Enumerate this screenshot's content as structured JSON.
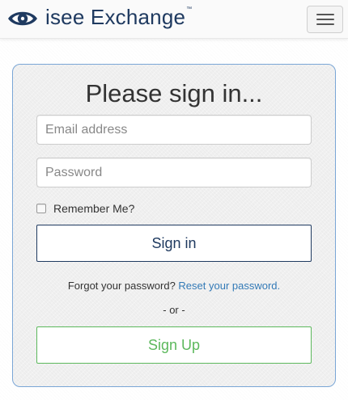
{
  "header": {
    "brand_name": "isee Exchange",
    "brand_trademark": "™",
    "logo_icon": "eye-icon",
    "menu_icon": "hamburger-menu-icon"
  },
  "signin": {
    "title": "Please sign in...",
    "email_placeholder": "Email address",
    "password_placeholder": "Password",
    "remember_label": "Remember Me?",
    "remember_checked": false,
    "signin_label": "Sign in",
    "forgot_text": "Forgot your password?",
    "reset_link": "Reset your password.",
    "or_text": "- or -",
    "signup_label": "Sign Up"
  },
  "colors": {
    "brand": "#1f3a60",
    "link": "#337ab7",
    "signup": "#5cb85c",
    "panel_border": "#7aa6d6"
  }
}
